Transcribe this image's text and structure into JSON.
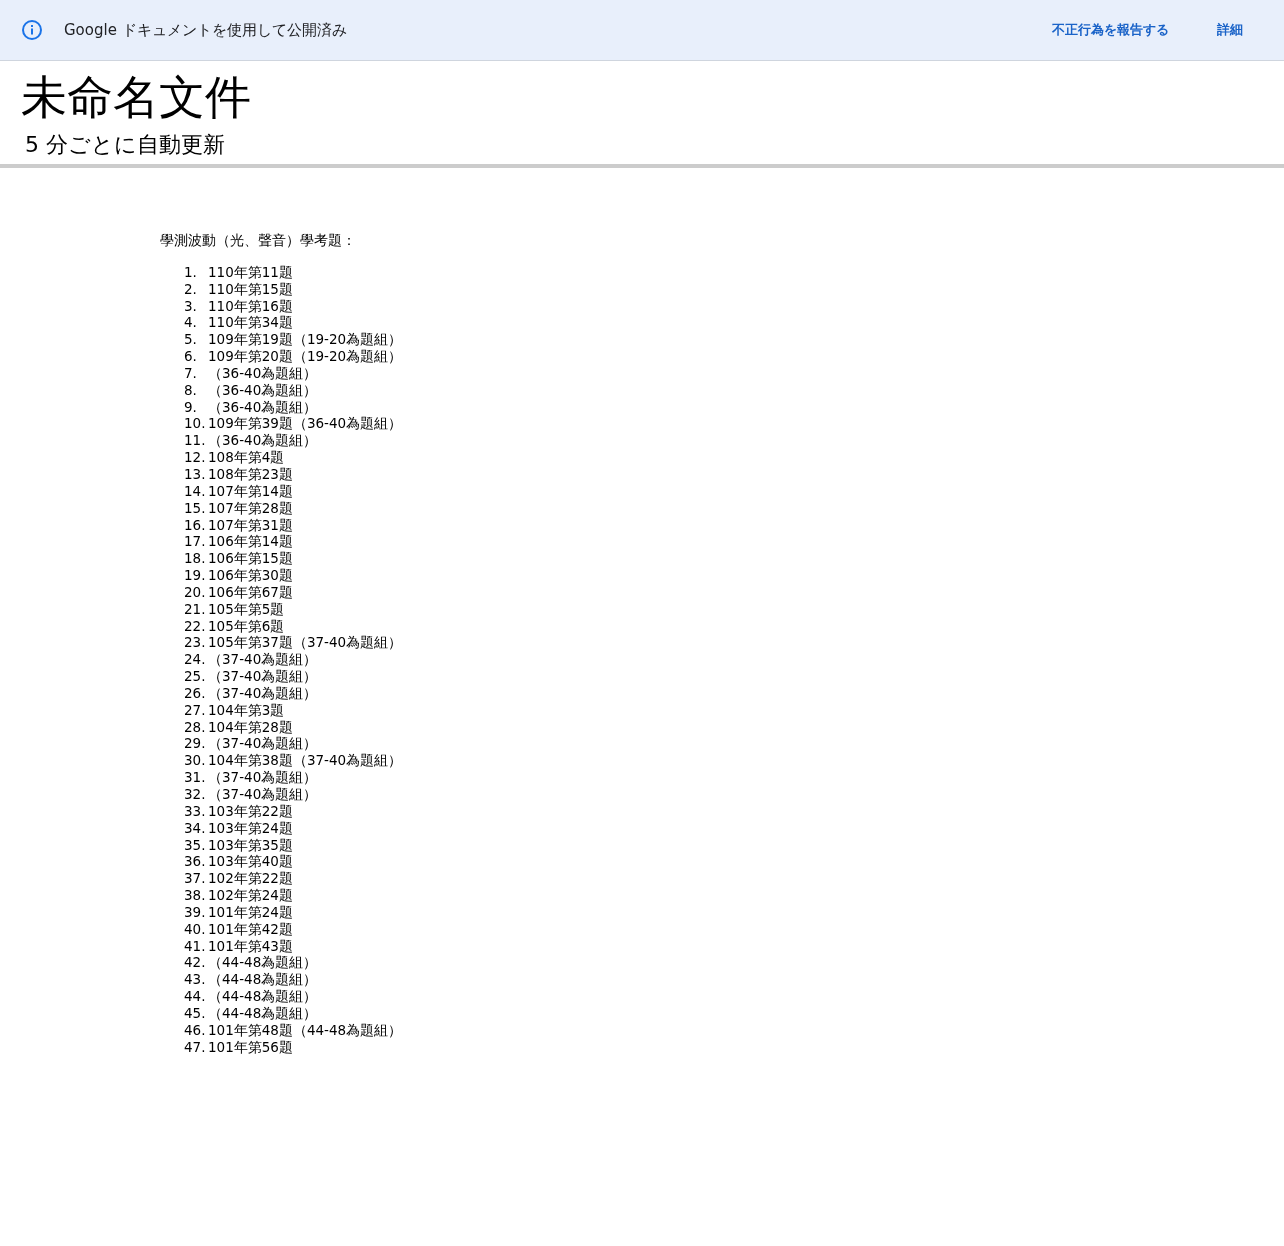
{
  "banner": {
    "message": "Google ドキュメントを使用して公開済み",
    "links": [
      "不正行為を報告する",
      "詳細"
    ]
  },
  "document": {
    "title": "未命名文件",
    "subtitle": "5 分ごとに自動更新"
  },
  "content": {
    "heading": "學測波動（光、聲音）學考題：",
    "items": [
      {
        "number": "1.",
        "text": "110年第11題"
      },
      {
        "number": "2.",
        "text": "110年第15題"
      },
      {
        "number": "3.",
        "text": "110年第16題"
      },
      {
        "number": "4.",
        "text": "110年第34題"
      },
      {
        "number": "5.",
        "text": "109年第19題（19-20為題組）"
      },
      {
        "number": "6.",
        "text": "109年第20題（19-20為題組）"
      },
      {
        "number": "7.",
        "text": "（36-40為題組）"
      },
      {
        "number": "8.",
        "text": "（36-40為題組）"
      },
      {
        "number": "9.",
        "text": "（36-40為題組）"
      },
      {
        "number": "10.",
        "text": "109年第39題（36-40為題組）"
      },
      {
        "number": "11.",
        "text": "（36-40為題組）"
      },
      {
        "number": "12.",
        "text": "108年第4題"
      },
      {
        "number": "13.",
        "text": "108年第23題"
      },
      {
        "number": "14.",
        "text": "107年第14題"
      },
      {
        "number": "15.",
        "text": "107年第28題"
      },
      {
        "number": "16.",
        "text": "107年第31題"
      },
      {
        "number": "17.",
        "text": "106年第14題"
      },
      {
        "number": "18.",
        "text": "106年第15題"
      },
      {
        "number": "19.",
        "text": "106年第30題"
      },
      {
        "number": "20.",
        "text": "106年第67題"
      },
      {
        "number": "21.",
        "text": "105年第5題"
      },
      {
        "number": "22.",
        "text": "105年第6題"
      },
      {
        "number": "23.",
        "text": "105年第37題（37-40為題組）"
      },
      {
        "number": "24.",
        "text": "（37-40為題組）"
      },
      {
        "number": "25.",
        "text": "（37-40為題組）"
      },
      {
        "number": "26.",
        "text": "（37-40為題組）"
      },
      {
        "number": "27.",
        "text": "104年第3題"
      },
      {
        "number": "28.",
        "text": "104年第28題"
      },
      {
        "number": "29.",
        "text": "（37-40為題組）"
      },
      {
        "number": "30.",
        "text": "104年第38題（37-40為題組）"
      },
      {
        "number": "31.",
        "text": "（37-40為題組）"
      },
      {
        "number": "32.",
        "text": "（37-40為題組）"
      },
      {
        "number": "33.",
        "text": "103年第22題"
      },
      {
        "number": "34.",
        "text": "103年第24題"
      },
      {
        "number": "35.",
        "text": "103年第35題"
      },
      {
        "number": "36.",
        "text": "103年第40題"
      },
      {
        "number": "37.",
        "text": "102年第22題"
      },
      {
        "number": "38.",
        "text": "102年第24題"
      },
      {
        "number": "39.",
        "text": "101年第24題"
      },
      {
        "number": "40.",
        "text": "101年第42題"
      },
      {
        "number": "41.",
        "text": "101年第43題"
      },
      {
        "number": "42.",
        "text": "（44-48為題組）"
      },
      {
        "number": "43.",
        "text": "（44-48為題組）"
      },
      {
        "number": "44.",
        "text": "（44-48為題組）"
      },
      {
        "number": "45.",
        "text": "（44-48為題組）"
      },
      {
        "number": "46.",
        "text": "101年第48題（44-48為題組）"
      },
      {
        "number": "47.",
        "text": "101年第56題"
      }
    ]
  }
}
